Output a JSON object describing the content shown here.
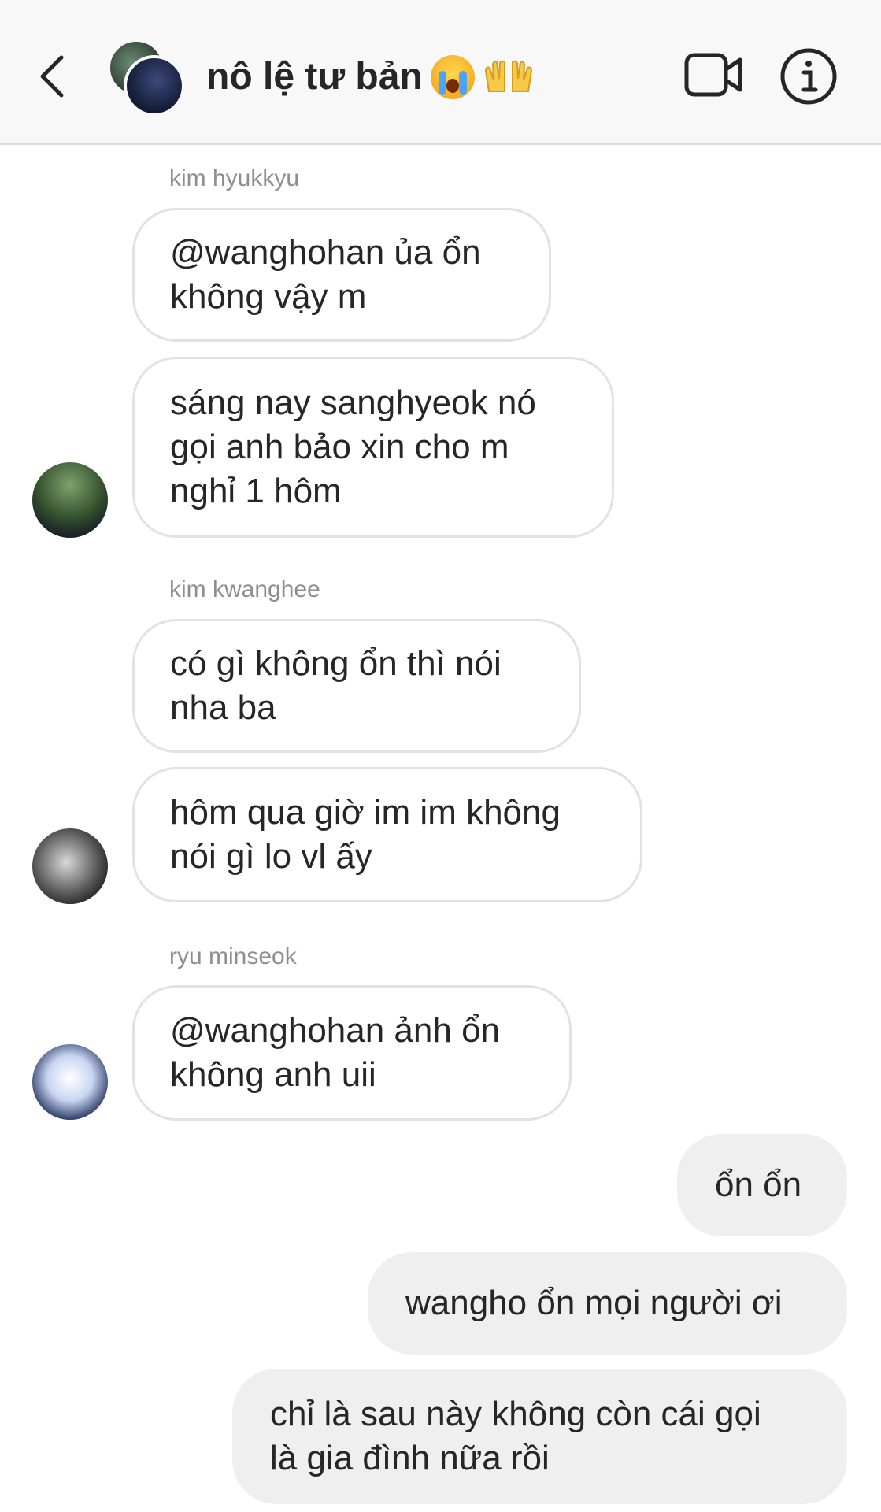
{
  "header": {
    "title": "nô lệ tư bản",
    "title_emoji_1": "loudly-crying-face",
    "title_emoji_2": "raising-hands",
    "icons": {
      "back": "chevron-left-icon",
      "video": "video-camera-icon",
      "info": "info-icon"
    }
  },
  "messages": [
    {
      "sender": "kim hyukkyu",
      "texts": [
        "@wanghohan ủa ổn\nkhông vậy m",
        "sáng nay sanghyeok nó\ngọi anh bảo xin cho m\nnghỉ 1 hôm"
      ]
    },
    {
      "sender": "kim kwanghee",
      "texts": [
        "có gì không ổn thì nói\nnha ba",
        "hôm qua giờ im im không\nnói gì lo vl ấy"
      ]
    },
    {
      "sender": "ryu minseok",
      "texts": [
        "@wanghohan ảnh ổn\nkhông anh uii"
      ]
    }
  ],
  "my_messages": [
    "ổn ổn",
    "wangho ổn mọi người ơi",
    "chỉ là sau này không còn cái gọi\nlà gia đình nữa rồi"
  ],
  "colors": {
    "header_bg": "#f8f8f8",
    "incoming_border": "#e2e2e2",
    "outgoing_bg": "#efefef",
    "sender_text": "#8e8e8e"
  }
}
